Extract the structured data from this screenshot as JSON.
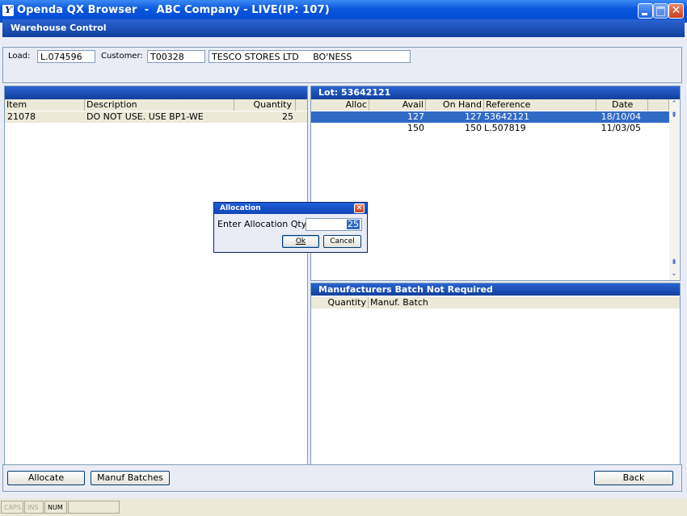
{
  "window": {
    "title": "Openda QX Browser  -  ABC Company - LIVE(IP: 107)",
    "app_icon": "Ƴ"
  },
  "header": {
    "title": "Warehouse Control"
  },
  "load_panel": {
    "load_label": "Load:",
    "load_value": "L.074596",
    "customer_label": "Customer:",
    "customer_code": "T00328",
    "customer_name": "TESCO STORES LTD     BO'NESS"
  },
  "items_panel": {
    "title": "",
    "columns": [
      "Item",
      "Description",
      "Quantity"
    ],
    "rows": [
      {
        "item": "21078",
        "description": "DO NOT USE. USE BP1-WE",
        "quantity": "25"
      }
    ]
  },
  "lot_panel": {
    "title": "Lot: 53642121",
    "columns": [
      "Alloc",
      "Avail",
      "On Hand",
      "Reference",
      "Date"
    ],
    "rows": [
      {
        "alloc": "",
        "avail": "127",
        "on_hand": "127",
        "reference": "53642121",
        "date": "18/10/04",
        "selected": true
      },
      {
        "alloc": "",
        "avail": "150",
        "on_hand": "150",
        "reference": "L.507819",
        "date": "11/03/05",
        "selected": false
      }
    ]
  },
  "batch_panel": {
    "title": "Manufacturers Batch Not Required",
    "columns": [
      "Quantity",
      "Manuf. Batch"
    ]
  },
  "buttons": {
    "allocate": "Allocate",
    "manuf_batches": "Manuf Batches",
    "back": "Back"
  },
  "status": {
    "caps": "CAPS",
    "ins": "INS",
    "num": "NUM"
  },
  "dialog": {
    "title": "Allocation",
    "label": "Enter Allocation Qty:",
    "value": "25",
    "ok": "Ok",
    "cancel": "Cancel"
  },
  "colors": {
    "titlebar": "#0a56dc",
    "panel_header": "#1c50b8",
    "selection": "#316ac5",
    "background": "#eaecf5"
  }
}
